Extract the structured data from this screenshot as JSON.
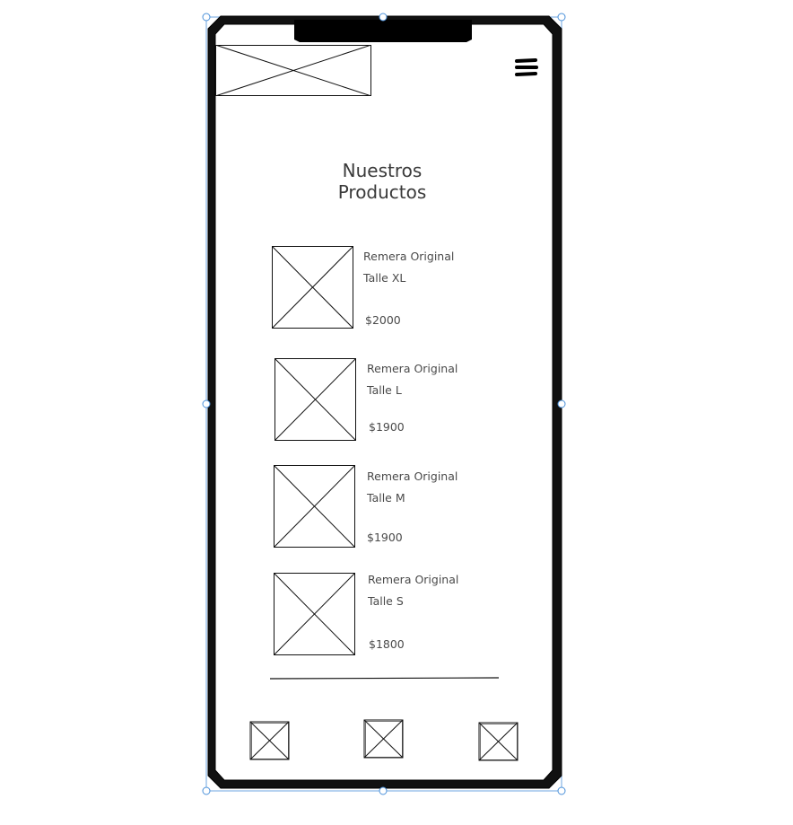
{
  "header": {
    "logo_icon": "image-placeholder-icon",
    "menu_icon": "hamburger-menu-icon"
  },
  "page": {
    "title_line1": "Nuestros",
    "title_line2": "Productos"
  },
  "products": [
    {
      "name": "Remera Original",
      "size": "Talle XL",
      "price": "$2000"
    },
    {
      "name": "Remera Original",
      "size": "Talle L",
      "price": "$1900"
    },
    {
      "name": "Remera Original",
      "size": "Talle M",
      "price": "$1900"
    },
    {
      "name": "Remera Original",
      "size": "Talle S",
      "price": "$1800"
    }
  ],
  "bottom_nav": {
    "icons": [
      "image-placeholder-icon",
      "image-placeholder-icon",
      "image-placeholder-icon"
    ]
  }
}
